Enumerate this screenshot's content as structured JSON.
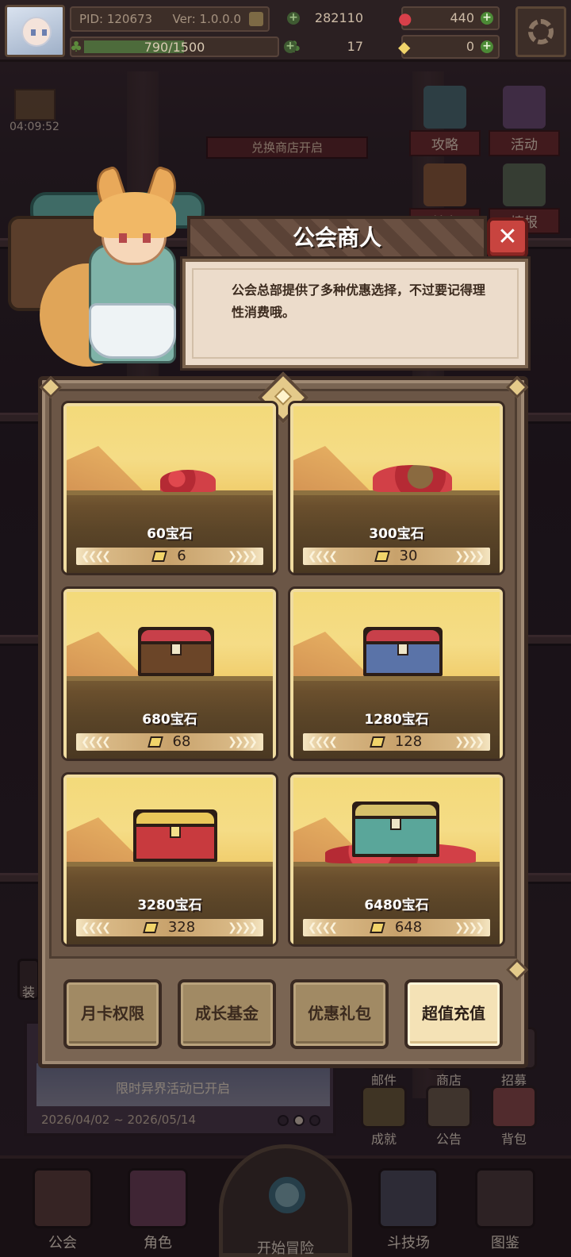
{
  "topbar": {
    "pid": "PID: 120673",
    "version": "Ver: 1.0.0.0",
    "xp": "790/1500",
    "xp_fraction": 0.527,
    "gold": "282110",
    "gems": "440",
    "clover": "17",
    "coupons": "0"
  },
  "side": {
    "timer": "04:09:52",
    "guide": "攻略",
    "activity": "活动",
    "first_charge": "首充",
    "intel": "情报",
    "exchange_banner": "兑换商店开启"
  },
  "dialog": {
    "title": "公会商人",
    "text": "公会总部提供了多种优惠选择，不过要记得理性消费哦。"
  },
  "shop": {
    "items": [
      {
        "name": "60宝石",
        "price": "6"
      },
      {
        "name": "300宝石",
        "price": "30"
      },
      {
        "name": "680宝石",
        "price": "68"
      },
      {
        "name": "1280宝石",
        "price": "128"
      },
      {
        "name": "3280宝石",
        "price": "328"
      },
      {
        "name": "6480宝石",
        "price": "648"
      }
    ],
    "tabs": [
      "月卡权限",
      "成长基金",
      "优惠礼包",
      "超值充值"
    ],
    "active_tab": "超值充值"
  },
  "lower": {
    "event_title": "限时异界活动已开启",
    "event_dates": "2026/04/02 ~ 2026/05/14",
    "mini": [
      "邮件",
      "商店",
      "招募",
      "成就",
      "公告",
      "背包"
    ],
    "left_partial": "装"
  },
  "nav": {
    "guild": "公会",
    "character": "角色",
    "adventure": "开始冒险",
    "arena": "斗技场",
    "codex": "图鉴"
  },
  "colors": {
    "accent_red": "#c8443f",
    "gold_frame": "#f0dca0",
    "panel": "#7a6553"
  }
}
